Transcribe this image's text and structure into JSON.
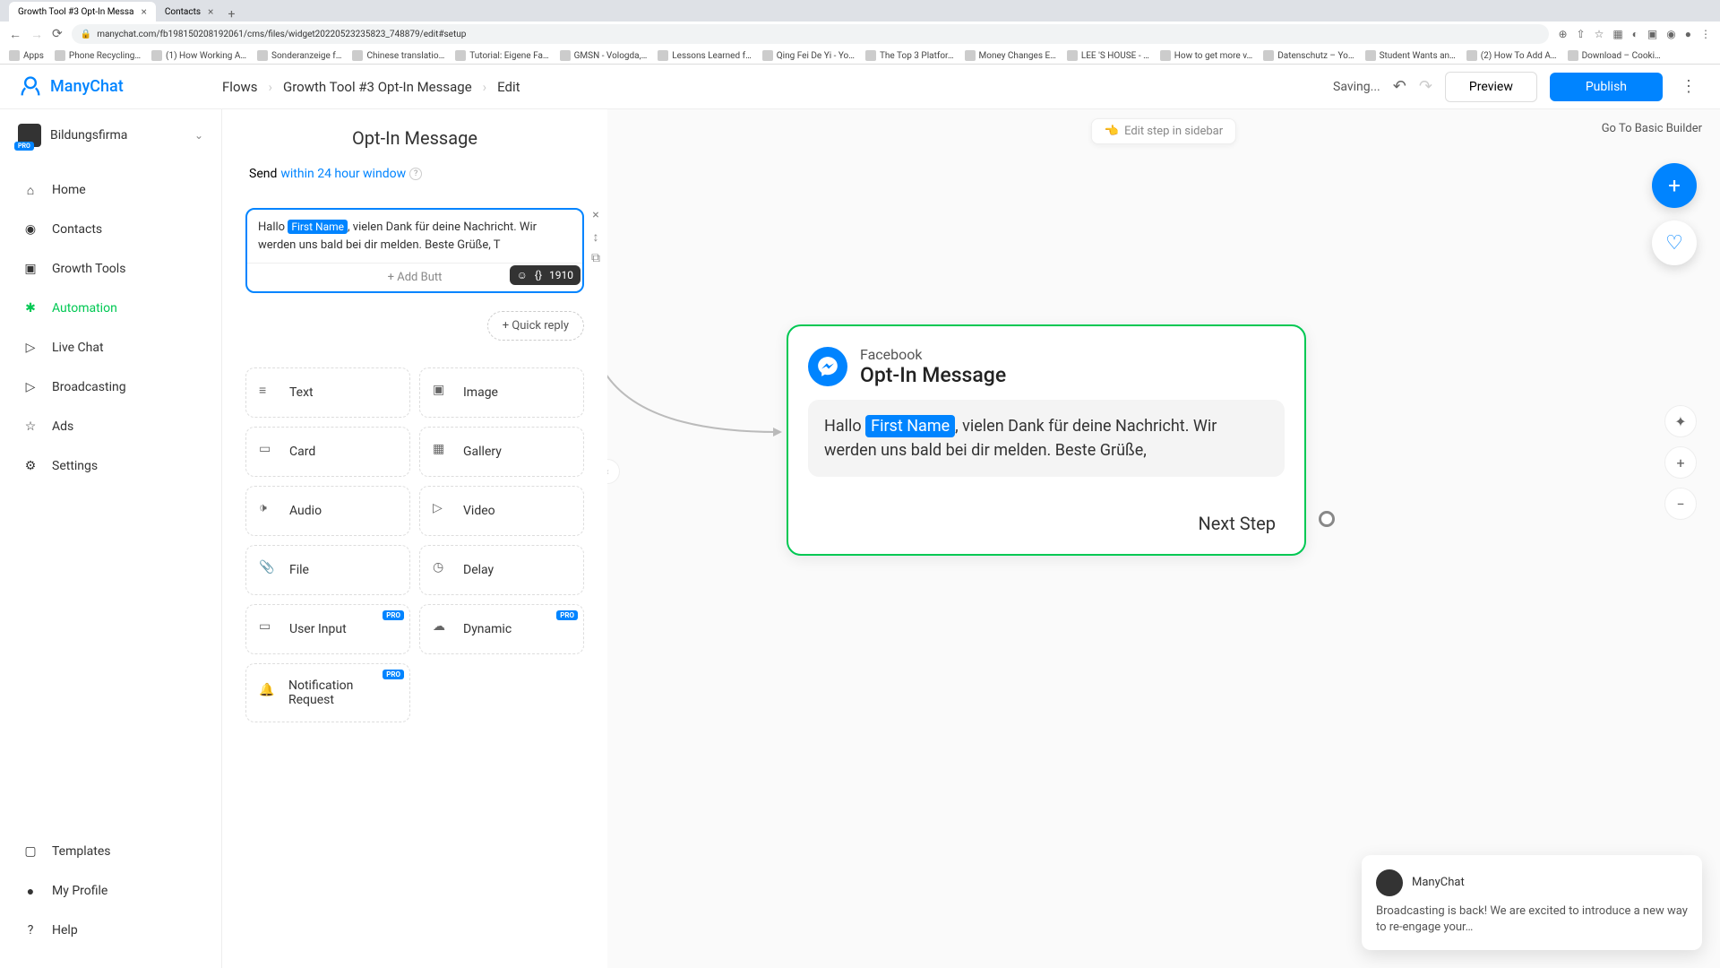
{
  "browser": {
    "tabs": [
      {
        "title": "Growth Tool #3 Opt-In Messa"
      },
      {
        "title": "Contacts"
      }
    ],
    "url": "manychat.com/fb198150208192061/cms/files/widget20220523235823_748879/edit#setup",
    "bookmarks": [
      "Apps",
      "Phone Recycling…",
      "(1) How Working A…",
      "Sonderanzeige f…",
      "Chinese translatio…",
      "Tutorial: Eigene Fa…",
      "GMSN - Vologda,…",
      "Lessons Learned f…",
      "Qing Fei De Yi - Yo…",
      "The Top 3 Platfor…",
      "Money Changes E…",
      "LEE 'S HOUSE - …",
      "How to get more v…",
      "Datenschutz – Yo…",
      "Student Wants an…",
      "(2) How To Add A…",
      "Download – Cooki…"
    ]
  },
  "header": {
    "logo": "ManyChat",
    "breadcrumb": [
      "Flows",
      "Growth Tool #3 Opt-In Message",
      "Edit"
    ],
    "saving": "Saving...",
    "preview": "Preview",
    "publish": "Publish"
  },
  "sidebar": {
    "org": "Bildungsfirma",
    "pro": "PRO",
    "items": [
      "Home",
      "Contacts",
      "Growth Tools",
      "Automation",
      "Live Chat",
      "Broadcasting",
      "Ads",
      "Settings"
    ],
    "bottom": [
      "Templates",
      "My Profile",
      "Help"
    ]
  },
  "editor": {
    "title": "Opt-In Message",
    "send_label": "Send",
    "send_link": "within 24 hour window",
    "msg_before": "Hallo ",
    "msg_tag": "First Name",
    "msg_after": ", vielen Dank für deine Nachricht. Wir werden uns bald bei dir melden. Beste Grüße, T",
    "add_button": "+ Add Butt",
    "char_count": "1910",
    "quick_reply": "+ Quick reply",
    "tiles": [
      "Text",
      "Image",
      "Card",
      "Gallery",
      "Audio",
      "Video",
      "File",
      "Delay",
      "User Input",
      "Dynamic",
      "Notification Request"
    ],
    "pro_tag": "PRO"
  },
  "canvas": {
    "edit_hint": "Edit step in sidebar",
    "basic_builder": "Go To Basic Builder",
    "flow": {
      "channel": "Facebook",
      "title": "Opt-In Message",
      "msg_before": "Hallo ",
      "msg_tag": "First Name",
      "msg_after": ", vielen Dank für deine Nachricht. Wir werden uns bald bei dir melden. Beste Grüße,",
      "next": "Next Step"
    }
  },
  "notif": {
    "from": "ManyChat",
    "body": "Broadcasting is back! We are excited to introduce a new way to re-engage your…"
  }
}
